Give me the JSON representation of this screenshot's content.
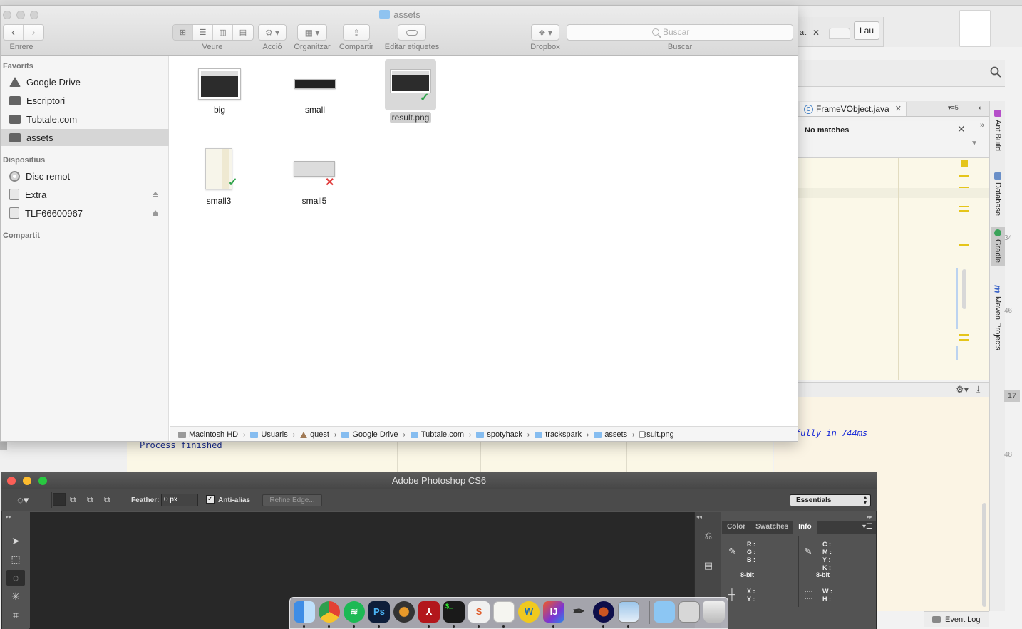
{
  "finder": {
    "title": "assets",
    "toolbar": {
      "back_label": "Enrere",
      "view_label": "Veure",
      "action_label": "Acció",
      "arrange_label": "Organitzar",
      "share_label": "Compartir",
      "tags_label": "Editar etiquetes",
      "dropbox_label": "Dropbox",
      "search_label": "Buscar",
      "search_placeholder": "Buscar"
    },
    "sidebar": {
      "favorites_heading": "Favorits",
      "favorites": [
        {
          "label": "Google Drive",
          "icon": "google-drive-icon"
        },
        {
          "label": "Escriptori",
          "icon": "folder-icon"
        },
        {
          "label": "Tubtale.com",
          "icon": "folder-icon"
        },
        {
          "label": "assets",
          "icon": "folder-icon",
          "selected": true
        }
      ],
      "devices_heading": "Dispositius",
      "devices": [
        {
          "label": "Disc remot",
          "icon": "disc-icon"
        },
        {
          "label": "Extra",
          "icon": "drive-icon",
          "ejectable": true
        },
        {
          "label": "TLF66600967",
          "icon": "drive-icon",
          "ejectable": true
        }
      ],
      "shared_heading": "Compartit"
    },
    "files": [
      {
        "name": "big",
        "badge": "none"
      },
      {
        "name": "small",
        "badge": "none"
      },
      {
        "name": "result.png",
        "badge": "synced",
        "selected": true
      },
      {
        "name": "small3",
        "badge": "synced"
      },
      {
        "name": "small5",
        "badge": "error"
      }
    ],
    "path": [
      "Macintosh HD",
      "Usuaris",
      "quest",
      "Google Drive",
      "Tubtale.com",
      "spotyhack",
      "trackspark",
      "assets",
      "result.png"
    ]
  },
  "ide": {
    "tab_label": "FrameVObject.java",
    "tab_menu": "▾≡5",
    "find_status": "No matches",
    "console_link": "fully in 744ms",
    "process_text": "Process finished",
    "side_tabs": [
      "Ant Build",
      "Database",
      "Gradle",
      "Maven Projects"
    ],
    "event_log": "Event Log",
    "badge_number": "17",
    "side_numbers": [
      "34",
      "46",
      "48"
    ]
  },
  "browser": {
    "tab_fragment": "at",
    "user_button": "Lau"
  },
  "photoshop": {
    "title": "Adobe Photoshop CS6",
    "feather_label": "Feather:",
    "feather_value": "0 px",
    "antialias_label": "Anti-alias",
    "refine_edge_label": "Refine Edge...",
    "workspace": "Essentials",
    "panel_tabs": [
      "Color",
      "Swatches",
      "Info"
    ],
    "info": {
      "rgb": "R :\nG :\nB :",
      "cmyk": "C :\nM :\nY :\nK :",
      "bit_left": "8-bit",
      "bit_right": "8-bit",
      "xy": "X :\nY :",
      "wh": "W :\nH :"
    }
  },
  "dock": {
    "apps": [
      "Finder",
      "Chrome",
      "Spotify",
      "Photoshop",
      "Logic",
      "Acrobat",
      "Terminal",
      "Sublime",
      "Notes",
      "Wunderlist",
      "IntelliJ",
      "Inkscape",
      "Audition",
      "Preview",
      "Folder",
      "Screenshot",
      "Trash"
    ]
  }
}
